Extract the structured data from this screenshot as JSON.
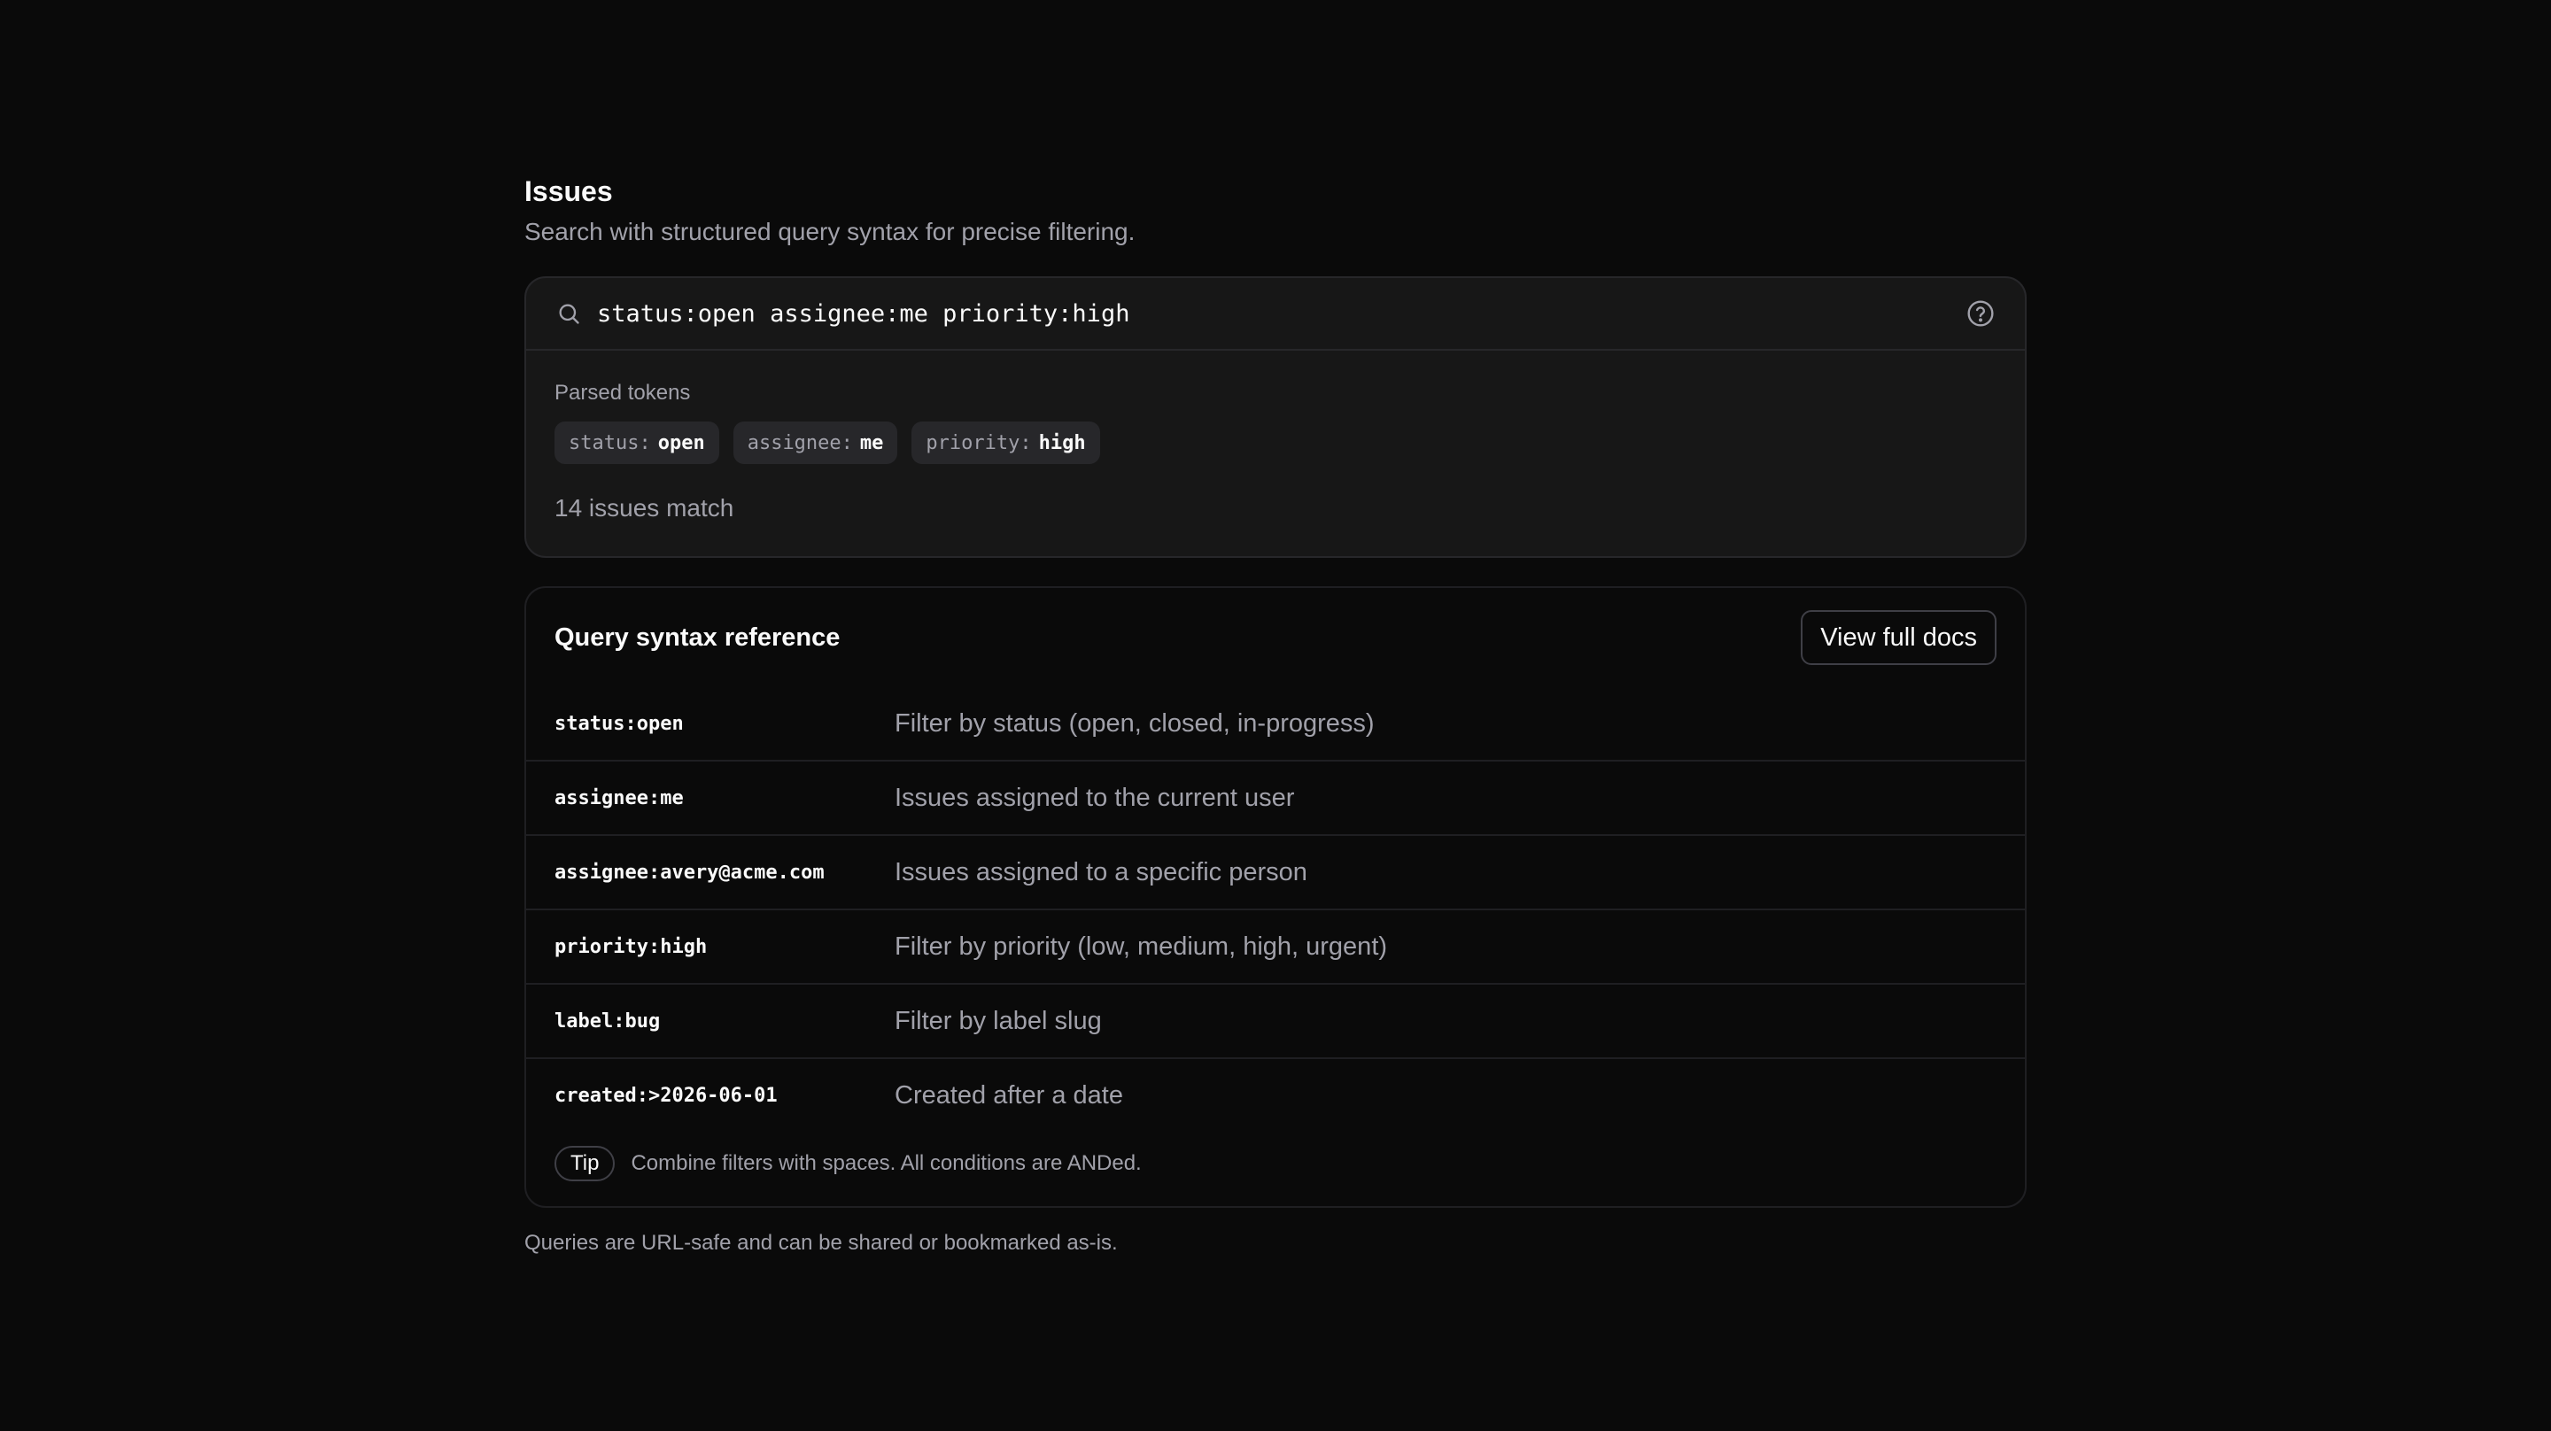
{
  "header": {
    "title": "Issues",
    "subtitle": "Search with structured query syntax for precise filtering."
  },
  "search": {
    "value": "status:open assignee:me priority:high",
    "icon": "search-icon",
    "help_icon": "help-circle-icon"
  },
  "parsed": {
    "label": "Parsed tokens",
    "tokens": [
      {
        "key": "status:",
        "value": "open"
      },
      {
        "key": "assignee:",
        "value": "me"
      },
      {
        "key": "priority:",
        "value": "high"
      }
    ],
    "match_count": "14 issues match"
  },
  "reference": {
    "title": "Query syntax reference",
    "docs_button": "View full docs",
    "rows": [
      {
        "code": "status:open",
        "desc": "Filter by status (open, closed, in-progress)"
      },
      {
        "code": "assignee:me",
        "desc": "Issues assigned to the current user"
      },
      {
        "code": "assignee:avery@acme.com",
        "desc": "Issues assigned to a specific person"
      },
      {
        "code": "priority:high",
        "desc": "Filter by priority (low, medium, high, urgent)"
      },
      {
        "code": "label:bug",
        "desc": "Filter by label slug"
      },
      {
        "code": "created:>2026-06-01",
        "desc": "Created after a date"
      }
    ],
    "tip_badge": "Tip",
    "tip_text": "Combine filters with spaces. All conditions are ANDed."
  },
  "footnote": "Queries are URL-safe and can be shared or bookmarked as-is."
}
